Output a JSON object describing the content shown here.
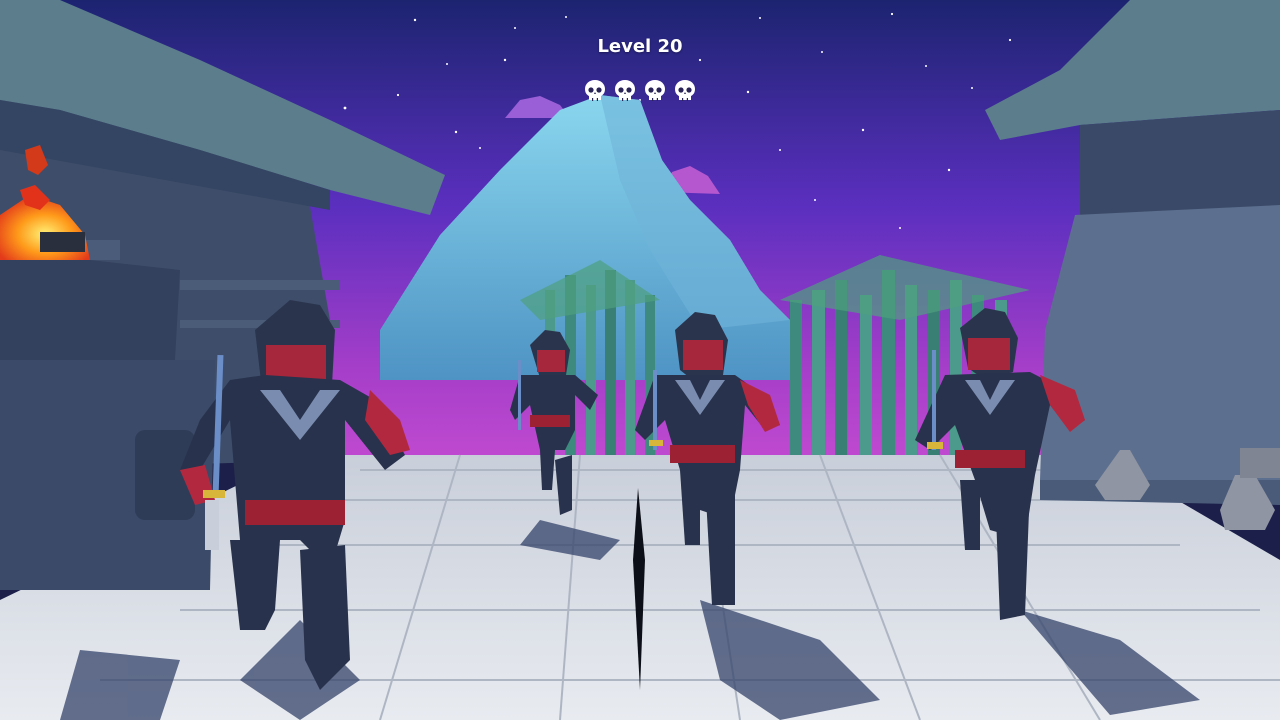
{
  "hud": {
    "level_label": "Level 20",
    "lives_remaining": 4,
    "life_icon": "skull-icon"
  },
  "enemies": [
    {
      "name": "ninja",
      "weapon": "katana"
    },
    {
      "name": "ninja",
      "weapon": "katana"
    },
    {
      "name": "ninja",
      "weapon": "katana"
    },
    {
      "name": "ninja",
      "weapon": "katana"
    }
  ],
  "player": {
    "weapon": "kunai"
  },
  "colors": {
    "sky_top": "#1e2a7a",
    "sky_bottom": "#9a3ed0",
    "mountain": "#7fcbe6",
    "ninja_body": "#26304a",
    "ninja_accent": "#c23547",
    "floor": "#d9dde3",
    "fire": "#ff8a1a"
  }
}
